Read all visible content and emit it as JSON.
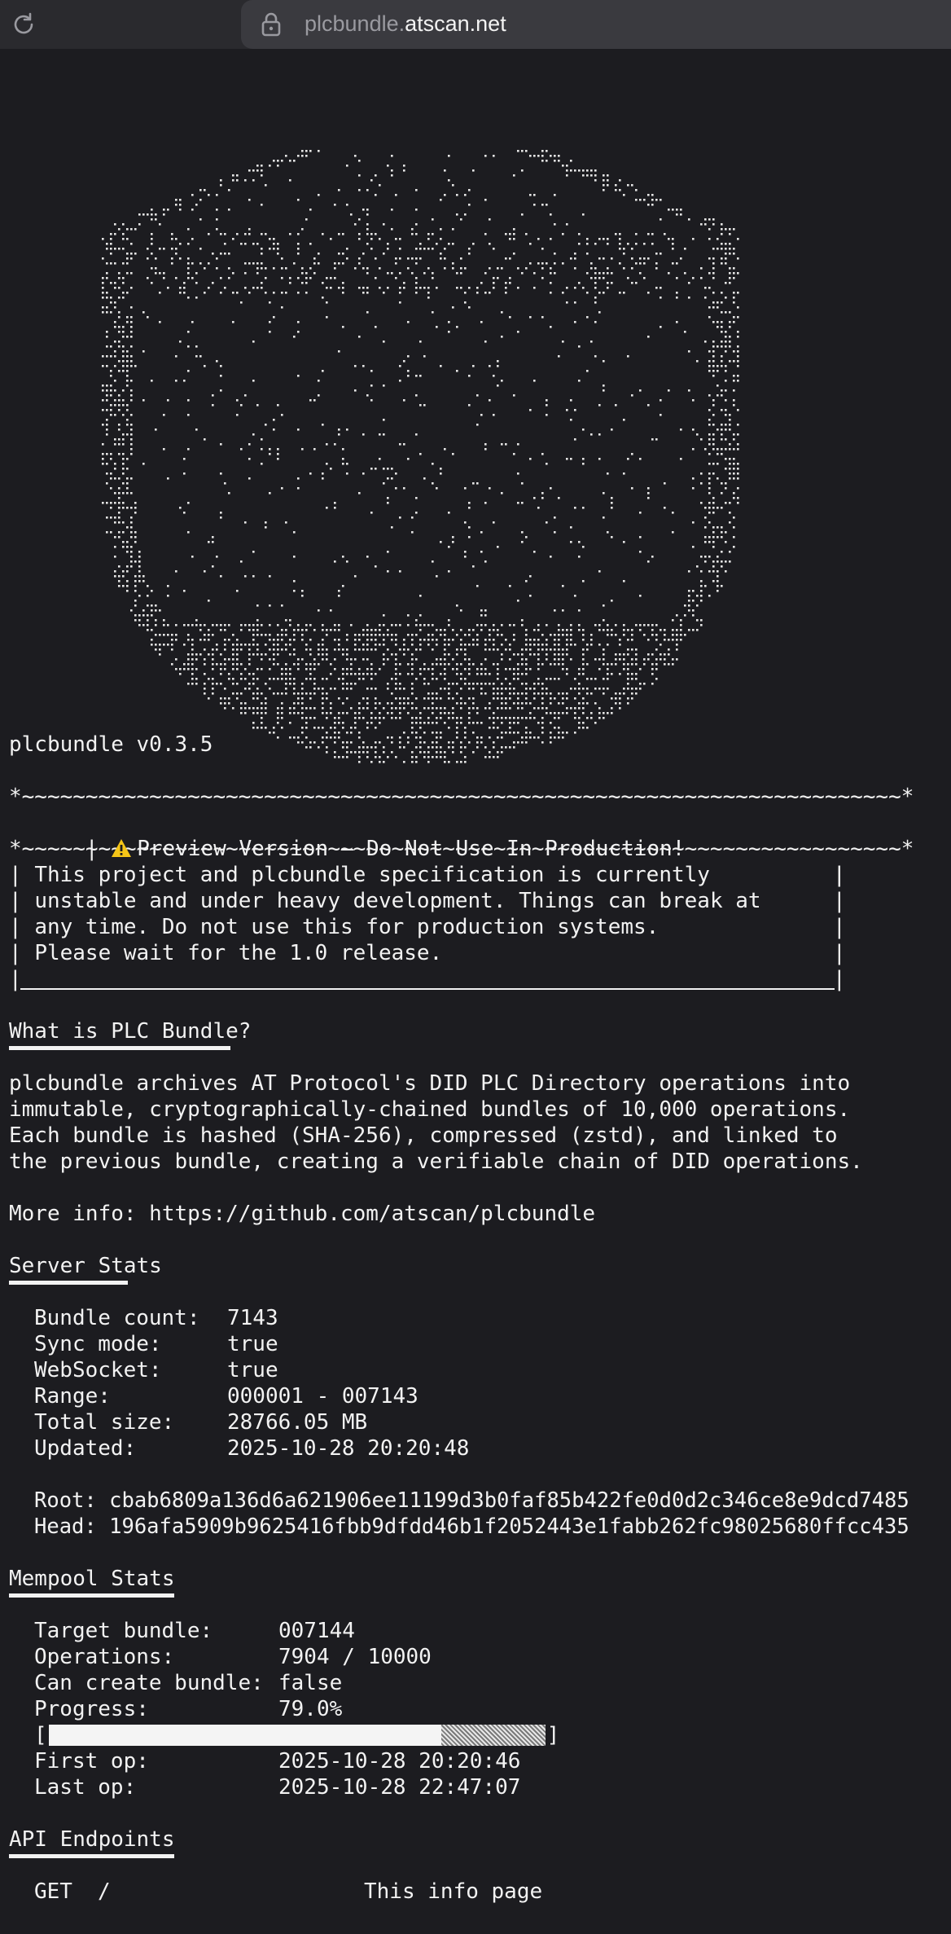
{
  "browser": {
    "url_subdomain": "plcbundle.",
    "url_domain": "atscan.net"
  },
  "version": "plcbundle v0.3.5",
  "preview_box": {
    "top_border": "*~~~~~~~~~~~~~~~~~~~~~~~~~~~~~~~~~~~~~~~~~~~~~~~~~~~~~~~~~~~~~~~~~~~~~*",
    "title": "Preview Version — Do Not Use In Production!",
    "lines": [
      "This project and plcbundle specification is currently",
      "unstable and under heavy development. Things can break at",
      "any time. Do not use this for production systems.",
      "Please wait for the 1.0 release."
    ]
  },
  "about": {
    "heading": "What is PLC Bundle?",
    "lines": [
      "plcbundle archives AT Protocol's DID PLC Directory operations into",
      "immutable, cryptographically-chained bundles of 10,000 operations.",
      "Each bundle is hashed (SHA-256), compressed (zstd), and linked to",
      "the previous bundle, creating a verifiable chain of DID operations."
    ],
    "more_info": "More info: https://github.com/atscan/plcbundle"
  },
  "server_stats": {
    "heading": "Server Stats",
    "rows": [
      {
        "label": "Bundle count:",
        "value": "7143"
      },
      {
        "label": "Sync mode:",
        "value": "true"
      },
      {
        "label": "WebSocket:",
        "value": "true"
      },
      {
        "label": "Range:",
        "value": "000001 - 007143"
      },
      {
        "label": "Total size:",
        "value": "28766.05 MB"
      },
      {
        "label": "Updated:",
        "value": "2025-10-28 20:20:48"
      }
    ],
    "hashes": [
      {
        "label": "Root:",
        "value": "cbab6809a136d6a621906ee11199d3b0faf85b422fe0d0d2c346ce8e9dcd7485"
      },
      {
        "label": "Head:",
        "value": "196afa5909b9625416fbb9dfdd46b1f2052443e1fabb262fc98025680ffcc435"
      }
    ]
  },
  "mempool_stats": {
    "heading": "Mempool Stats",
    "rows": [
      {
        "label": "Target bundle:",
        "value": "007144"
      },
      {
        "label": "Operations:",
        "value": "7904 / 10000"
      },
      {
        "label": "Can create bundle:",
        "value": "false"
      },
      {
        "label": "Progress:",
        "value": "79.0%"
      }
    ],
    "progress_fraction": 0.79,
    "times": [
      {
        "label": "First op:",
        "value": "2025-10-28 20:20:46"
      },
      {
        "label": "Last op:",
        "value": "2025-10-28 22:47:07"
      }
    ]
  },
  "api": {
    "heading": "API Endpoints",
    "endpoints": [
      {
        "method": "GET",
        "path": "/",
        "description": "This info page"
      }
    ]
  },
  "colors": {
    "background": "#1c1c20",
    "text": "#f2f2f2",
    "warning": "#f5c518"
  }
}
